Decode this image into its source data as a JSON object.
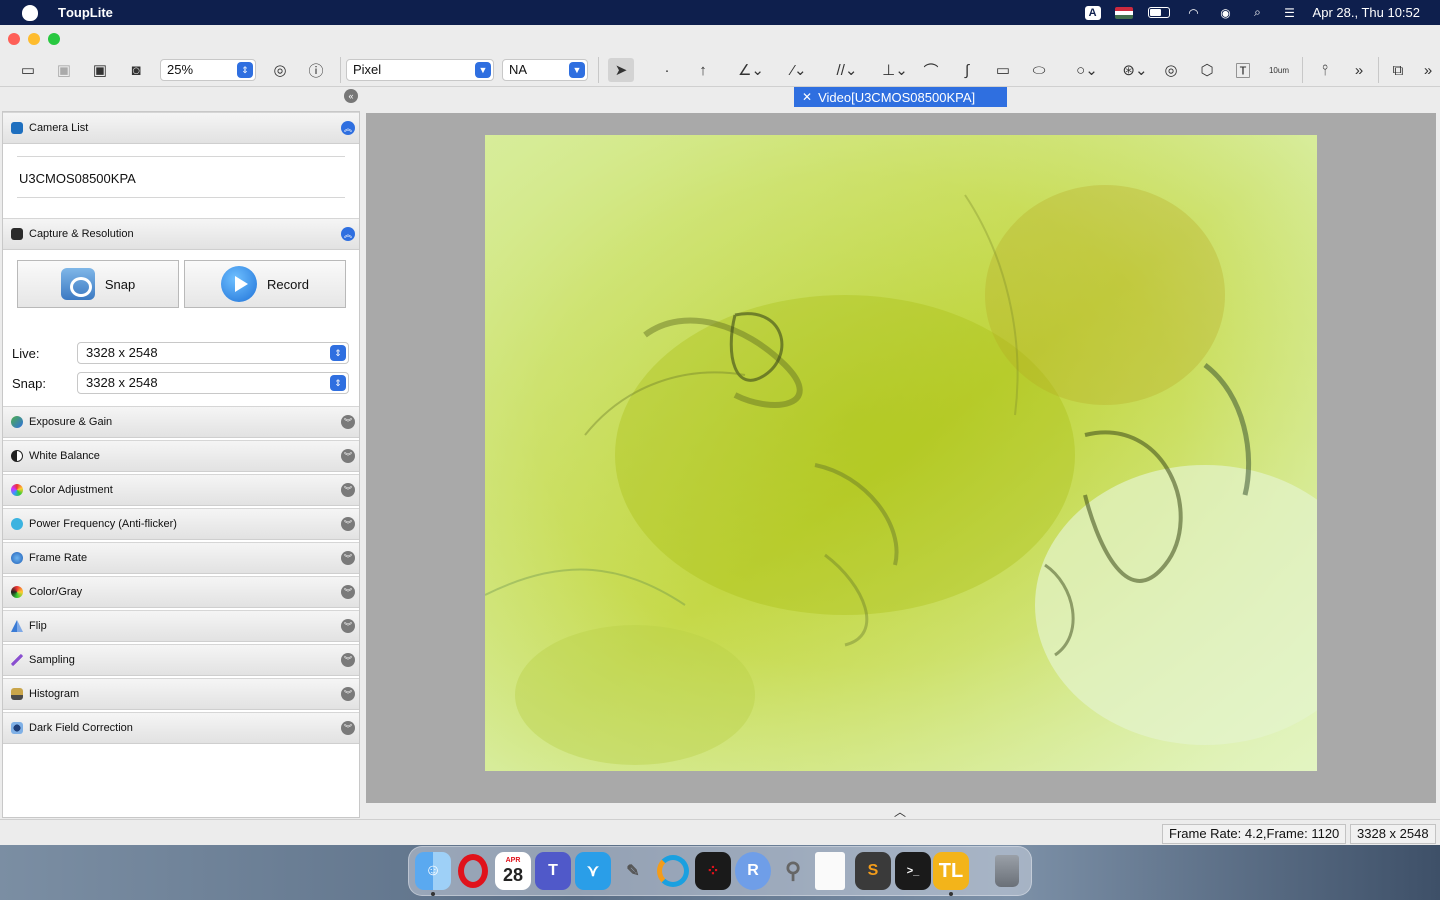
{
  "menubar": {
    "app_name": "TоupLite",
    "clock": "Apr 28., Thu 10:52"
  },
  "toolbar": {
    "zoom_value": "25%",
    "unit_value": "Pixel",
    "magnification_value": "NA",
    "scale_label": "10um"
  },
  "document": {
    "tab_title": "Video[U3CMOS08500KPA]"
  },
  "panel": {
    "camera_list": {
      "title": "Camera List",
      "camera_name": "U3CMOS08500KPA"
    },
    "capture": {
      "title": "Capture & Resolution",
      "snap_label": "Snap",
      "record_label": "Record",
      "live_label": "Live:",
      "live_value": "3328 x 2548",
      "snap_res_label": "Snap:",
      "snap_res_value": "3328 x 2548"
    },
    "sections": [
      {
        "title": "Exposure & Gain"
      },
      {
        "title": "White Balance"
      },
      {
        "title": "Color Adjustment"
      },
      {
        "title": "Power Frequency (Anti-flicker)"
      },
      {
        "title": "Frame Rate"
      },
      {
        "title": "Color/Gray"
      },
      {
        "title": "Flip"
      },
      {
        "title": "Sampling"
      },
      {
        "title": "Histogram"
      },
      {
        "title": "Dark Field Correction"
      }
    ]
  },
  "status": {
    "frame_info": "Frame Rate: 4.2,Frame: 1120",
    "resolution": "3328 x 2548"
  },
  "dock": {
    "calendar_month": "APR",
    "calendar_day": "28"
  },
  "colors": {
    "accent": "#2f6fe0",
    "menubar": "#0e1f4d"
  }
}
